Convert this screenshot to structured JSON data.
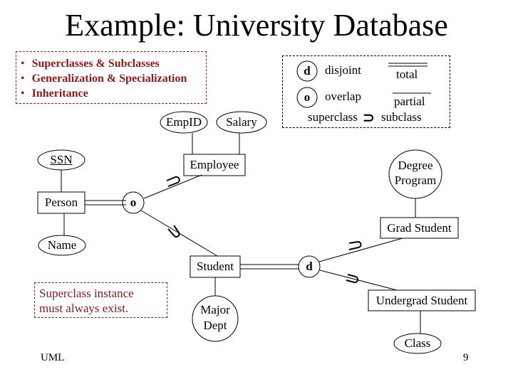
{
  "title": "Example: University Database",
  "notes": {
    "bullets": [
      "Superclasses & Subclasses",
      "Generalization & Specialization",
      "Inheritance"
    ],
    "constraint_note": [
      "Superclass instance",
      "must always exist."
    ]
  },
  "legend": {
    "disjoint_symbol": "d",
    "disjoint_label": "disjoint",
    "overlap_symbol": "o",
    "overlap_label": "overlap",
    "total_label": "total",
    "partial_label": "partial",
    "superclass_label": "superclass",
    "subset_symbol": "⊃",
    "subclass_label": "subclass"
  },
  "entities": {
    "person": "Person",
    "employee": "Employee",
    "student": "Student",
    "grad_student": "Grad Student",
    "undergrad_student": "Undergrad Student"
  },
  "attributes": {
    "ssn": "SSN",
    "name": "Name",
    "empid": "EmpID",
    "salary": "Salary",
    "major_dept": [
      "Major",
      "Dept"
    ],
    "degree_program": [
      "Degree",
      "Program"
    ],
    "class": "Class"
  },
  "specializations": {
    "person_spec": "o",
    "student_spec": "d"
  },
  "footer": {
    "left": "UML",
    "page_number": "9"
  },
  "colors": {
    "note_text": "#8b1a1a",
    "line": "#000000"
  }
}
